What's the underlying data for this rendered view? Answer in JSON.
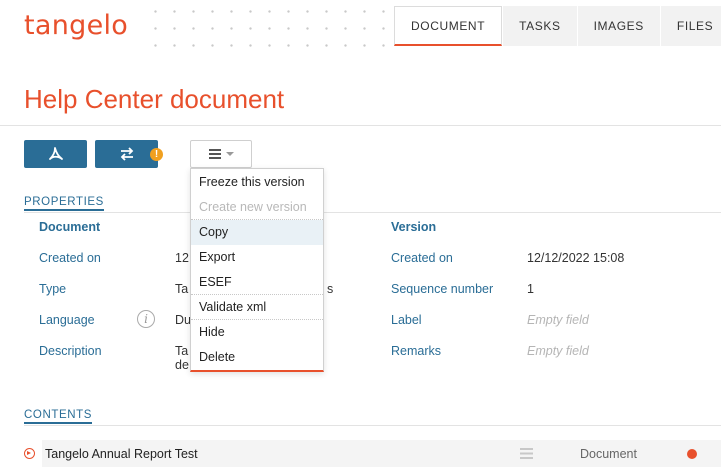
{
  "app": {
    "logo": "tangelo"
  },
  "tabs": [
    {
      "label": "DOCUMENT",
      "active": true
    },
    {
      "label": "TASKS"
    },
    {
      "label": "IMAGES"
    },
    {
      "label": "FILES"
    }
  ],
  "page": {
    "title": "Help Center document"
  },
  "toolbar": {
    "pdf_icon": "pdf-icon",
    "swap_icon": "swap-arrows-icon",
    "warning_badge": "!",
    "menu_icon": "hamburger-icon"
  },
  "dropdown": {
    "items": [
      {
        "label": "Freeze this version"
      },
      {
        "label": "Create new version",
        "disabled": true
      },
      {
        "label": "Copy"
      },
      {
        "label": "Export"
      },
      {
        "label": "ESEF"
      },
      {
        "label": "Validate xml"
      },
      {
        "label": "Hide"
      },
      {
        "label": "Delete"
      }
    ]
  },
  "properties": {
    "section_label": "PROPERTIES",
    "document": {
      "heading": "Document",
      "rows": [
        {
          "label": "Created on",
          "value": "12"
        },
        {
          "label": "Type",
          "value": "Ta"
        },
        {
          "label": "Language",
          "value": "Du"
        },
        {
          "label": "Description",
          "value": "Ta",
          "value2": "de"
        }
      ]
    },
    "version": {
      "heading": "Version",
      "rows": [
        {
          "label": "Created on",
          "value": "12/12/2022 15:08"
        },
        {
          "label": "Sequence number",
          "value": "1"
        },
        {
          "label": "Label",
          "value": "Empty field"
        },
        {
          "label": "Remarks",
          "value": "Empty field"
        }
      ]
    },
    "hidden_fragment": "s"
  },
  "contents": {
    "section_label": "CONTENTS",
    "rows": [
      {
        "title": "Tangelo Annual Report Test",
        "type": "Document",
        "status_color": "#e8502c"
      }
    ]
  },
  "colors": {
    "accent": "#e8502c",
    "primary": "#2a6d96"
  }
}
